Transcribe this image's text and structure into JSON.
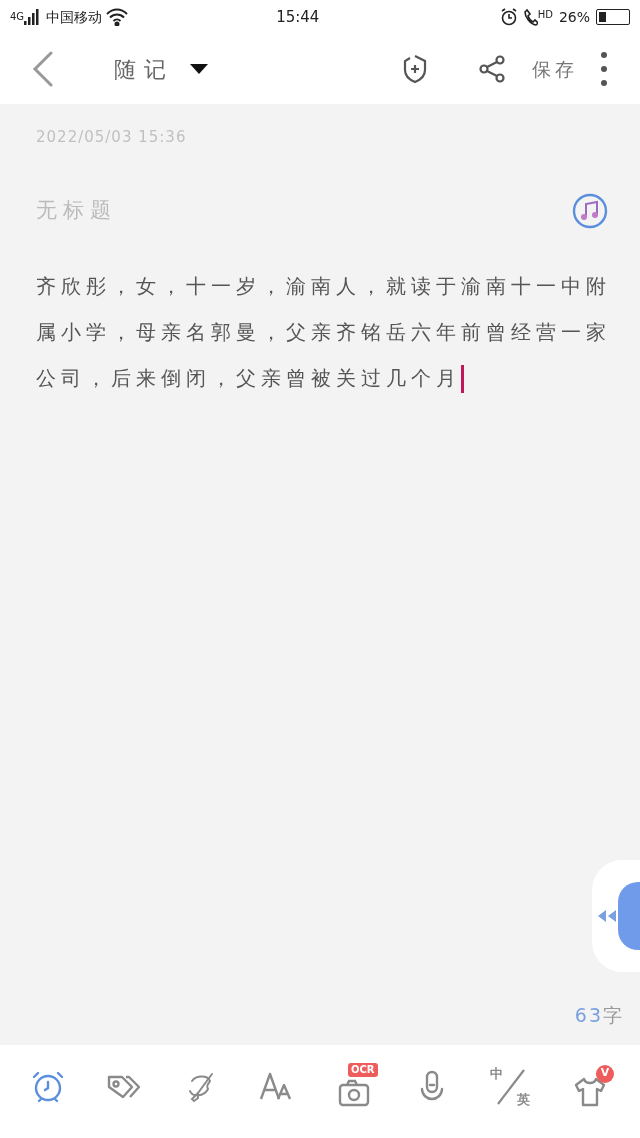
{
  "status_bar": {
    "network": "4G",
    "carrier": "中国移动",
    "time": "15:44",
    "hd": "HD",
    "battery": "26%"
  },
  "header": {
    "title": "随记",
    "save": "保存"
  },
  "note": {
    "timestamp": "2022/05/03 15:36",
    "title_placeholder": "无标题",
    "body": "齐欣彤，女，十一岁，渝南人，就读于渝南十一中附属小学，母亲名郭曼，父亲齐铭岳六年前曾经营一家公司，后来倒闭，父亲曾被关过几个月"
  },
  "count": {
    "number": "63",
    "unit": "字"
  },
  "toolbar": [
    {
      "kind": "alarm",
      "selected": true
    },
    {
      "kind": "tag",
      "selected": false
    },
    {
      "kind": "paint",
      "selected": false
    },
    {
      "kind": "font",
      "selected": false
    },
    {
      "kind": "camera",
      "badge": "OCR",
      "selected": false
    },
    {
      "kind": "mic",
      "selected": false
    },
    {
      "kind": "translate",
      "top": "中",
      "bottom": "英",
      "selected": false
    },
    {
      "kind": "shirt",
      "badge": "V",
      "selected": false
    }
  ]
}
